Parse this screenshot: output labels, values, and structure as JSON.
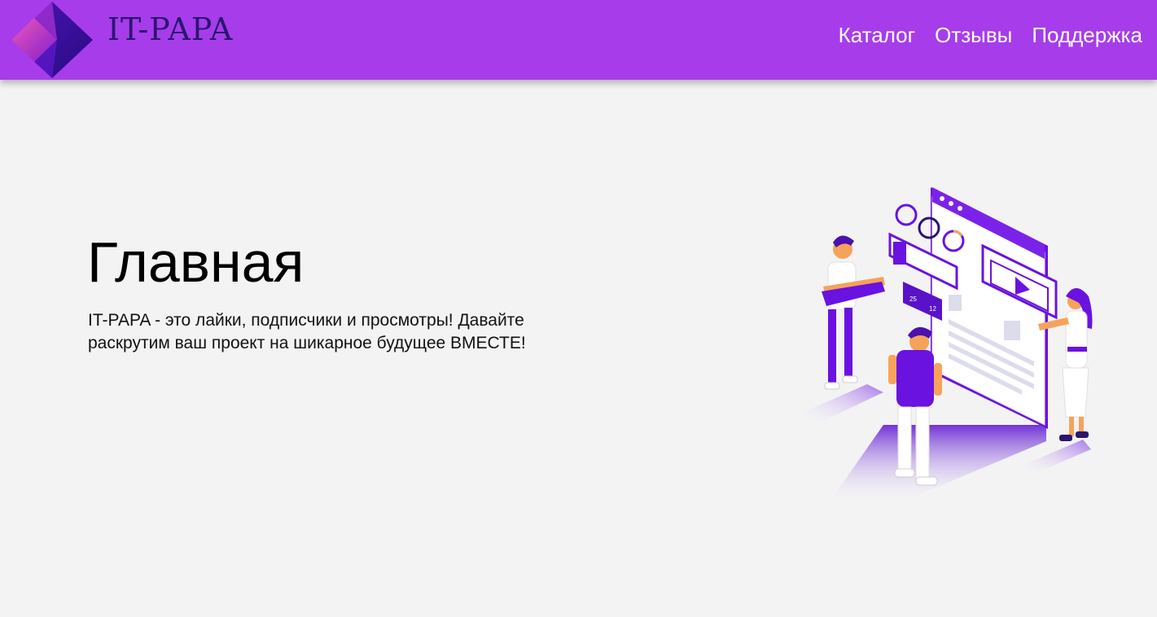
{
  "colors": {
    "header_bg": "#a73ceb",
    "page_bg": "#f3f3f3",
    "logo_text": "#2a1670",
    "nav_text": "#ffffff",
    "accent_purple": "#6a12e0",
    "accent_orange": "#f5a35a"
  },
  "header": {
    "logo_text": "IT-PAPA",
    "logo_icon": "diamond-cube-logo",
    "nav": [
      {
        "label": "Каталог"
      },
      {
        "label": "Отзывы"
      },
      {
        "label": "Поддержка"
      }
    ]
  },
  "hero": {
    "title": "Главная",
    "text": "IT-PAPA - это лайки, подписчики и просмотры! Давайте раскрутим ваш проект на шикарное будущее ВМЕСТЕ!",
    "illustration": {
      "like_count": "25",
      "comment_count": "12"
    }
  }
}
